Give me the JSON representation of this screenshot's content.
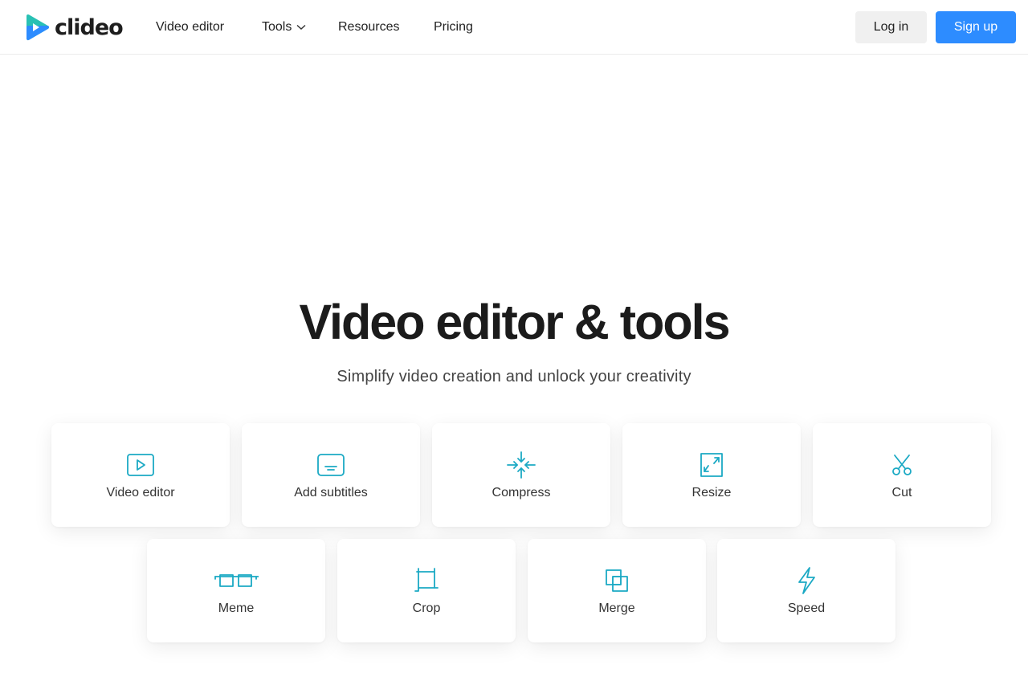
{
  "header": {
    "logo_text": "clideo",
    "nav": [
      {
        "label": "Video editor"
      },
      {
        "label": "Tools"
      },
      {
        "label": "Resources"
      },
      {
        "label": "Pricing"
      }
    ],
    "login_label": "Log in",
    "signup_label": "Sign up"
  },
  "hero": {
    "title": "Video editor & tools",
    "subtitle": "Simplify video creation and unlock your creativity"
  },
  "tools": [
    {
      "label": "Video editor",
      "icon": "play-icon"
    },
    {
      "label": "Add subtitles",
      "icon": "subtitles-icon"
    },
    {
      "label": "Compress",
      "icon": "compress-icon"
    },
    {
      "label": "Resize",
      "icon": "resize-icon"
    },
    {
      "label": "Cut",
      "icon": "scissors-icon"
    },
    {
      "label": "Meme",
      "icon": "meme-glasses-icon"
    },
    {
      "label": "Crop",
      "icon": "crop-icon"
    },
    {
      "label": "Merge",
      "icon": "merge-icon"
    },
    {
      "label": "Speed",
      "icon": "lightning-icon"
    }
  ],
  "colors": {
    "accent": "#2d8cff",
    "icon": "#1ba9c4",
    "logo_teal": "#29c1b4",
    "logo_blue": "#2d8cff"
  }
}
